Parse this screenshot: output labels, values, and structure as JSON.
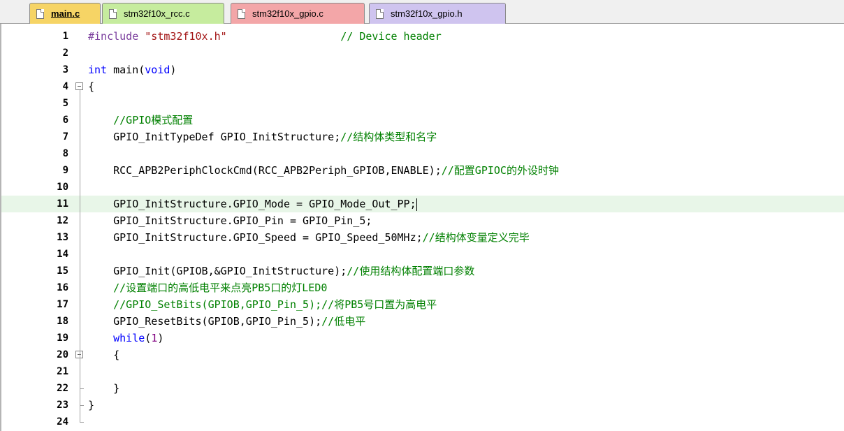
{
  "tabs": [
    {
      "label": "main.c",
      "color": "#f6d465",
      "active": true
    },
    {
      "label": "stm32f10x_rcc.c",
      "color": "#c6ec9e",
      "active": false
    },
    {
      "label": "stm32f10x_gpio.c",
      "color": "#f3a6a8",
      "active": false
    },
    {
      "label": "stm32f10x_gpio.h",
      "color": "#cfc4ef",
      "active": false
    }
  ],
  "editor": {
    "current_line": 11,
    "lines": [
      {
        "n": "1",
        "text": "#include \"stm32f10x.h\"                  // Device header"
      },
      {
        "n": "2",
        "text": ""
      },
      {
        "n": "3",
        "text": "int main(void)"
      },
      {
        "n": "4",
        "text": "{"
      },
      {
        "n": "5",
        "text": ""
      },
      {
        "n": "6",
        "text": "    //GPIO模式配置"
      },
      {
        "n": "7",
        "text": "    GPIO_InitTypeDef GPIO_InitStructure;//结构体类型和名字"
      },
      {
        "n": "8",
        "text": ""
      },
      {
        "n": "9",
        "text": "    RCC_APB2PeriphClockCmd(RCC_APB2Periph_GPIOB,ENABLE);//配置GPIOC的外设时钟"
      },
      {
        "n": "10",
        "text": ""
      },
      {
        "n": "11",
        "text": "    GPIO_InitStructure.GPIO_Mode = GPIO_Mode_Out_PP;"
      },
      {
        "n": "12",
        "text": "    GPIO_InitStructure.GPIO_Pin = GPIO_Pin_5;"
      },
      {
        "n": "13",
        "text": "    GPIO_InitStructure.GPIO_Speed = GPIO_Speed_50MHz;//结构体变量定义完毕"
      },
      {
        "n": "14",
        "text": ""
      },
      {
        "n": "15",
        "text": "    GPIO_Init(GPIOB,&GPIO_InitStructure);//使用结构体配置端口参数"
      },
      {
        "n": "16",
        "text": "    //设置端口的高低电平来点亮PB5口的灯LED0"
      },
      {
        "n": "17",
        "text": "    //GPIO_SetBits(GPIOB,GPIO_Pin_5);//将PB5号口置为高电平"
      },
      {
        "n": "18",
        "text": "    GPIO_ResetBits(GPIOB,GPIO_Pin_5);//低电平"
      },
      {
        "n": "19",
        "text": "    while(1)"
      },
      {
        "n": "20",
        "text": "    {"
      },
      {
        "n": "21",
        "text": ""
      },
      {
        "n": "22",
        "text": "    }"
      },
      {
        "n": "23",
        "text": "}"
      },
      {
        "n": "24",
        "text": ""
      }
    ]
  }
}
